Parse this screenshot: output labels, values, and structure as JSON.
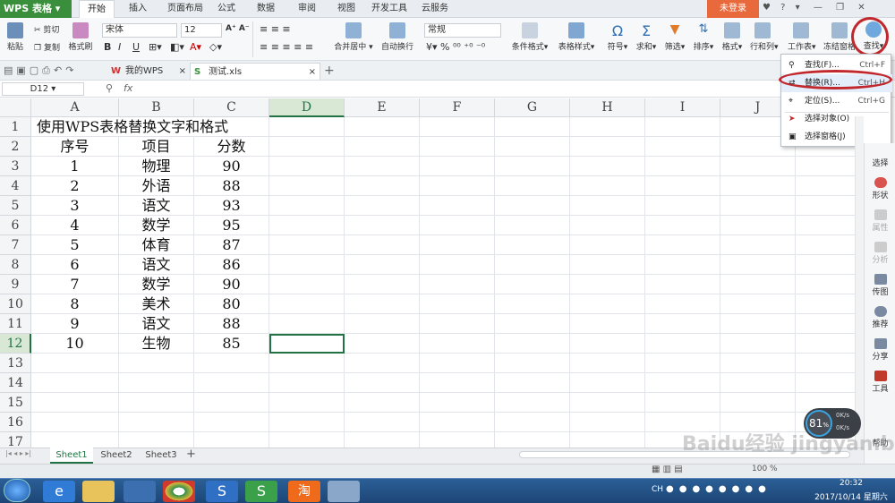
{
  "app": {
    "name": "WPS 表格",
    "login": "未登录"
  },
  "ribbon_tabs": [
    "开始",
    "插入",
    "页面布局",
    "公式",
    "数据",
    "审阅",
    "视图",
    "开发工具",
    "云服务"
  ],
  "ribbon": {
    "paste": "粘贴",
    "cut": "剪切",
    "copy": "复制",
    "format_painter": "格式刷",
    "font_name": "宋体",
    "font_size": "12",
    "merge_center": "合并居中",
    "wrap_text": "自动换行",
    "number_format": "常规",
    "cond_format": "条件格式",
    "table_style": "表格样式",
    "symbol": "符号",
    "sum": "求和",
    "filter": "筛选",
    "sort": "排序",
    "format": "格式",
    "row_col": "行和列",
    "worksheet": "工作表",
    "freeze": "冻结窗格",
    "find": "查找"
  },
  "doc_tabs": [
    "我的WPS",
    "测试.xls"
  ],
  "formula_bar": {
    "cell_ref": "D12",
    "fx": "fx",
    "value": ""
  },
  "columns": [
    "A",
    "B",
    "C",
    "D",
    "E",
    "F",
    "G",
    "H",
    "I",
    "J"
  ],
  "rows": [
    "1",
    "2",
    "3",
    "4",
    "5",
    "6",
    "7",
    "8",
    "9",
    "10",
    "11",
    "12",
    "13",
    "14",
    "15",
    "16",
    "17"
  ],
  "title_cell": "使用WPS表格替换文字和格式",
  "table": [
    [
      "序号",
      "项目",
      "分数"
    ],
    [
      "1",
      "物理",
      "90"
    ],
    [
      "2",
      "外语",
      "88"
    ],
    [
      "3",
      "语文",
      "93"
    ],
    [
      "4",
      "数学",
      "95"
    ],
    [
      "5",
      "体育",
      "87"
    ],
    [
      "6",
      "语文",
      "86"
    ],
    [
      "7",
      "数学",
      "90"
    ],
    [
      "8",
      "美术",
      "80"
    ],
    [
      "9",
      "语文",
      "88"
    ],
    [
      "10",
      "生物",
      "85"
    ]
  ],
  "find_menu": [
    {
      "label": "查找(F)...",
      "shortcut": "Ctrl+F"
    },
    {
      "label": "替换(R)...",
      "shortcut": "Ctrl+H"
    },
    {
      "label": "定位(S)...",
      "shortcut": "Ctrl+G"
    },
    {
      "label": "选择对象(O)",
      "shortcut": ""
    },
    {
      "label": "选择窗格(J)",
      "shortcut": ""
    }
  ],
  "side_panel": [
    "选择",
    "形状",
    "属性",
    "分析",
    "传图",
    "推荐",
    "分享",
    "工具",
    "帮助"
  ],
  "sheets": [
    "Sheet1",
    "Sheet2",
    "Sheet3"
  ],
  "network": {
    "percent": "81",
    "unit": "%",
    "up": "0K/s",
    "down": "0K/s"
  },
  "status": {
    "zoom": "100 %"
  },
  "watermark": "Baidu经验 jingyan.baidu.com",
  "taskbar": {
    "time": "20:32",
    "date": "2017/10/14 星期六",
    "lang": "CH"
  },
  "colors": {
    "accent": "#3a8f3c",
    "selection": "#217346",
    "highlight": "#c0282d"
  }
}
